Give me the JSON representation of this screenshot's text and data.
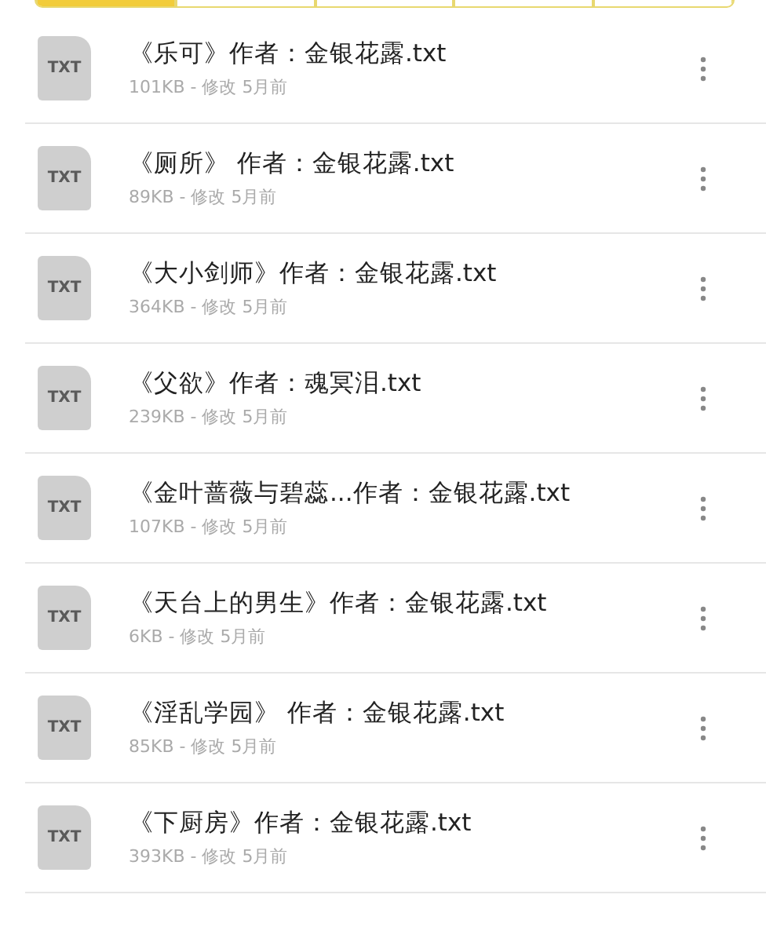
{
  "tab_strip": [
    {
      "selected": true
    },
    {
      "selected": false
    },
    {
      "selected": false
    },
    {
      "selected": false
    },
    {
      "selected": false
    }
  ],
  "files": [
    {
      "icon_label": "TXT",
      "name": "《乐可》作者：金银花露.txt",
      "meta": "101KB - 修改 5月前"
    },
    {
      "icon_label": "TXT",
      "name": "《厕所》 作者：金银花露.txt",
      "meta": "89KB - 修改 5月前"
    },
    {
      "icon_label": "TXT",
      "name": "《大小剑师》作者：金银花露.txt",
      "meta": "364KB - 修改 5月前"
    },
    {
      "icon_label": "TXT",
      "name": "《父欲》作者：魂冥泪.txt",
      "meta": "239KB - 修改 5月前"
    },
    {
      "icon_label": "TXT",
      "name": "《金叶蔷薇与碧蕊...作者：金银花露.txt",
      "meta": "107KB - 修改 5月前"
    },
    {
      "icon_label": "TXT",
      "name": "《天台上的男生》作者：金银花露.txt",
      "meta": "6KB - 修改 5月前"
    },
    {
      "icon_label": "TXT",
      "name": "《淫乱学园》 作者：金银花露.txt",
      "meta": "85KB - 修改 5月前"
    },
    {
      "icon_label": "TXT",
      "name": "《下厨房》作者：金银花露.txt",
      "meta": "393KB - 修改 5月前"
    }
  ]
}
